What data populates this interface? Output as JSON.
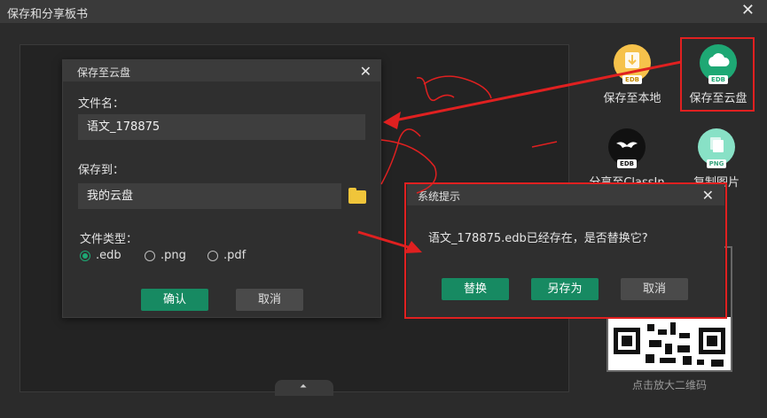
{
  "window": {
    "title": "保存和分享板书",
    "close_glyph": "✕"
  },
  "tools": [
    {
      "label": "保存至本地",
      "badge": "EDB"
    },
    {
      "label": "保存至云盘",
      "badge": "EDB"
    },
    {
      "label": "分享至ClassIn",
      "badge": "EDB"
    },
    {
      "label": "复制图片",
      "badge": "PNG"
    }
  ],
  "qr": {
    "label": "点击放大二维码"
  },
  "canvas": {
    "handle_glyph": "⏶"
  },
  "save_dialog": {
    "title": "保存至云盘",
    "close_glyph": "✕",
    "filename_label": "文件名：",
    "filename_value": "语文_178875",
    "saveto_label": "保存到：",
    "saveto_value": "我的云盘",
    "filetype_label": "文件类型：",
    "types": [
      ".edb",
      ".png",
      ".pdf"
    ],
    "selected_type": ".edb",
    "confirm_label": "确认",
    "cancel_label": "取消"
  },
  "alert_dialog": {
    "title": "系统提示",
    "close_glyph": "✕",
    "message": "语文_178875.edb已经存在，是否替换它?",
    "replace_label": "替换",
    "saveas_label": "另存为",
    "cancel_label": "取消"
  },
  "colors": {
    "accent": "#1ea874",
    "annotation": "#e02020"
  }
}
